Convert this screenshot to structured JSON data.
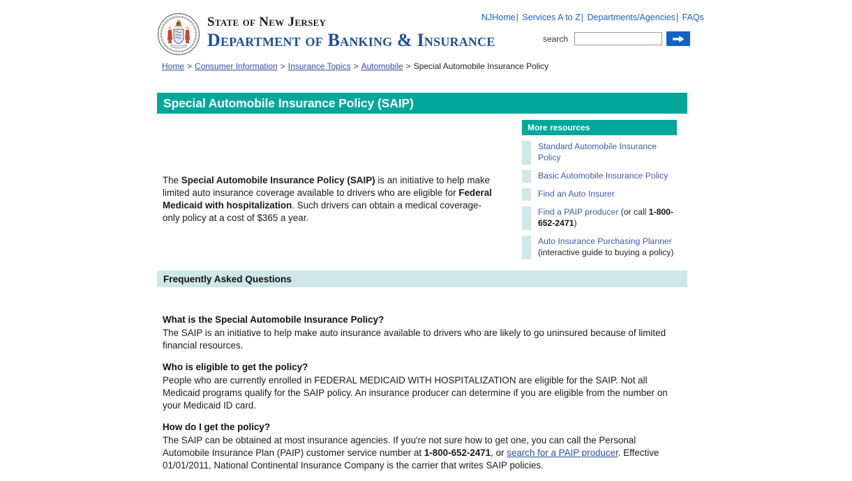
{
  "header": {
    "seal_alt": "great-seal-of-the-state-of-new-jersey",
    "line1": "State of New Jersey",
    "line2": "Department of Banking & Insurance"
  },
  "topnav": {
    "items": [
      {
        "label": "NJHome"
      },
      {
        "label": "Services A to Z"
      },
      {
        "label": "Departments/Agencies"
      },
      {
        "label": "FAQs"
      }
    ],
    "separator": "|"
  },
  "search": {
    "label": "search",
    "value": "",
    "placeholder": "",
    "button_icon": "right-arrow-icon",
    "button_color": "#1163c8"
  },
  "breadcrumb": {
    "separator": ">",
    "links": [
      {
        "label": "Home"
      },
      {
        "label": "Consumer Information"
      },
      {
        "label": "Insurance Topics"
      },
      {
        "label": "Automobile"
      }
    ],
    "current": "Special Automobile Insurance Policy"
  },
  "page_title": "Special Automobile Insurance Policy (SAIP)",
  "intro": {
    "part1": "The ",
    "bold1": "Special Automobile Insurance Policy (SAIP)",
    "part2": " is an initiative to help make limited auto insurance coverage available to drivers who are eligible for ",
    "bold2": "Federal Medicaid with hospitalization",
    "part3": ". Such drivers can obtain a medical coverage-only policy at a cost of $365 a year."
  },
  "resources": {
    "heading": "More resources",
    "items": [
      {
        "link": "Standard Automobile Insurance Policy",
        "suffix": "",
        "bold": "",
        "suffix2": "",
        "note": ""
      },
      {
        "link": "Basic Automobile Insurance Policy",
        "suffix": "",
        "bold": "",
        "suffix2": "",
        "note": ""
      },
      {
        "link": "Find an Auto Insurer",
        "suffix": "",
        "bold": "",
        "suffix2": "",
        "note": ""
      },
      {
        "link": "Find a PAIP producer",
        "suffix": " (or call ",
        "bold": "1-800-652-2471",
        "suffix2": ")",
        "note": ""
      },
      {
        "link": "Auto Insurance Purchasing Planner",
        "suffix": "",
        "bold": "",
        "suffix2": "",
        "note": "(interactive guide to buying a policy)"
      }
    ]
  },
  "faq": {
    "heading": "Frequently Asked Questions",
    "entries": [
      {
        "question": "What is the Special Automobile Insurance Policy?",
        "a1": "The SAIP is an initiative to help make auto insurance available to drivers who are likely to go uninsured because of limited financial resources.",
        "bold": "",
        "a2": "",
        "link": "",
        "a3": ""
      },
      {
        "question": "Who is eligible to get the policy?",
        "a1": "People who are currently enrolled in FEDERAL MEDICAID WITH HOSPITALIZATION are eligible for the SAIP. Not all Medicaid programs qualify for the SAIP policy. An insurance producer can determine if you are eligible from the number on your Medicaid ID card.",
        "bold": "",
        "a2": "",
        "link": "",
        "a3": ""
      },
      {
        "question": "How do I get the policy?",
        "a1": "The SAIP can be obtained at most insurance agencies. If you're not sure how to get one, you can call the Personal Automobile Insurance Plan (PAIP) customer service number at ",
        "bold": "1-800-652-2471",
        "a2": ", or ",
        "link": "search for a PAIP producer",
        "a3": ". Effective 01/01/2011, National Continental Insurance Company is the carrier that writes SAIP policies."
      }
    ]
  },
  "colors": {
    "teal": "#00a79a",
    "teal_light": "#cde8e5",
    "link_blue": "#2d4fa0",
    "brand_blue": "#1e4f9c"
  }
}
